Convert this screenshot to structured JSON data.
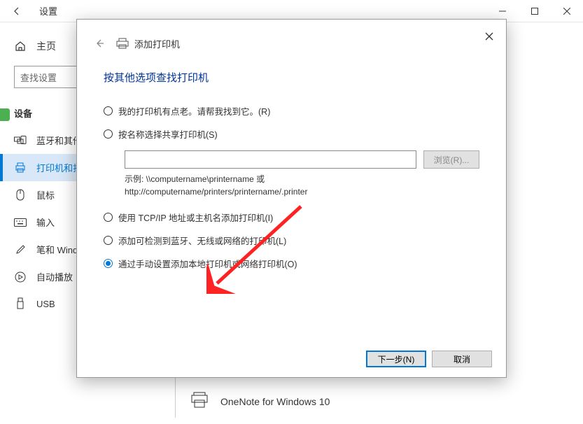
{
  "window": {
    "back_icon": "←",
    "title": "设置"
  },
  "sidebar": {
    "home": "主页",
    "search_placeholder": "查找设置",
    "section": "设备",
    "items": [
      {
        "label": "蓝牙和其他设备"
      },
      {
        "label": "打印机和扫描"
      },
      {
        "label": "鼠标"
      },
      {
        "label": "输入"
      },
      {
        "label": "笔和 Windows Ink"
      },
      {
        "label": "自动播放"
      },
      {
        "label": "USB"
      }
    ]
  },
  "content": {
    "printer_item": "OneNote for Windows 10"
  },
  "modal": {
    "header_label": "添加打印机",
    "heading": "按其他选项查找打印机",
    "options": [
      "我的打印机有点老。请帮我找到它。(R)",
      "按名称选择共享打印机(S)",
      "使用 TCP/IP 地址或主机名添加打印机(I)",
      "添加可检测到蓝牙、无线或网络的打印机(L)",
      "通过手动设置添加本地打印机或网络打印机(O)"
    ],
    "selected_index": 4,
    "browse_label": "浏览(R)...",
    "example_line1": "示例: \\\\computername\\printername 或",
    "example_line2": "http://computername/printers/printername/.printer",
    "next_label": "下一步(N)",
    "cancel_label": "取消"
  }
}
